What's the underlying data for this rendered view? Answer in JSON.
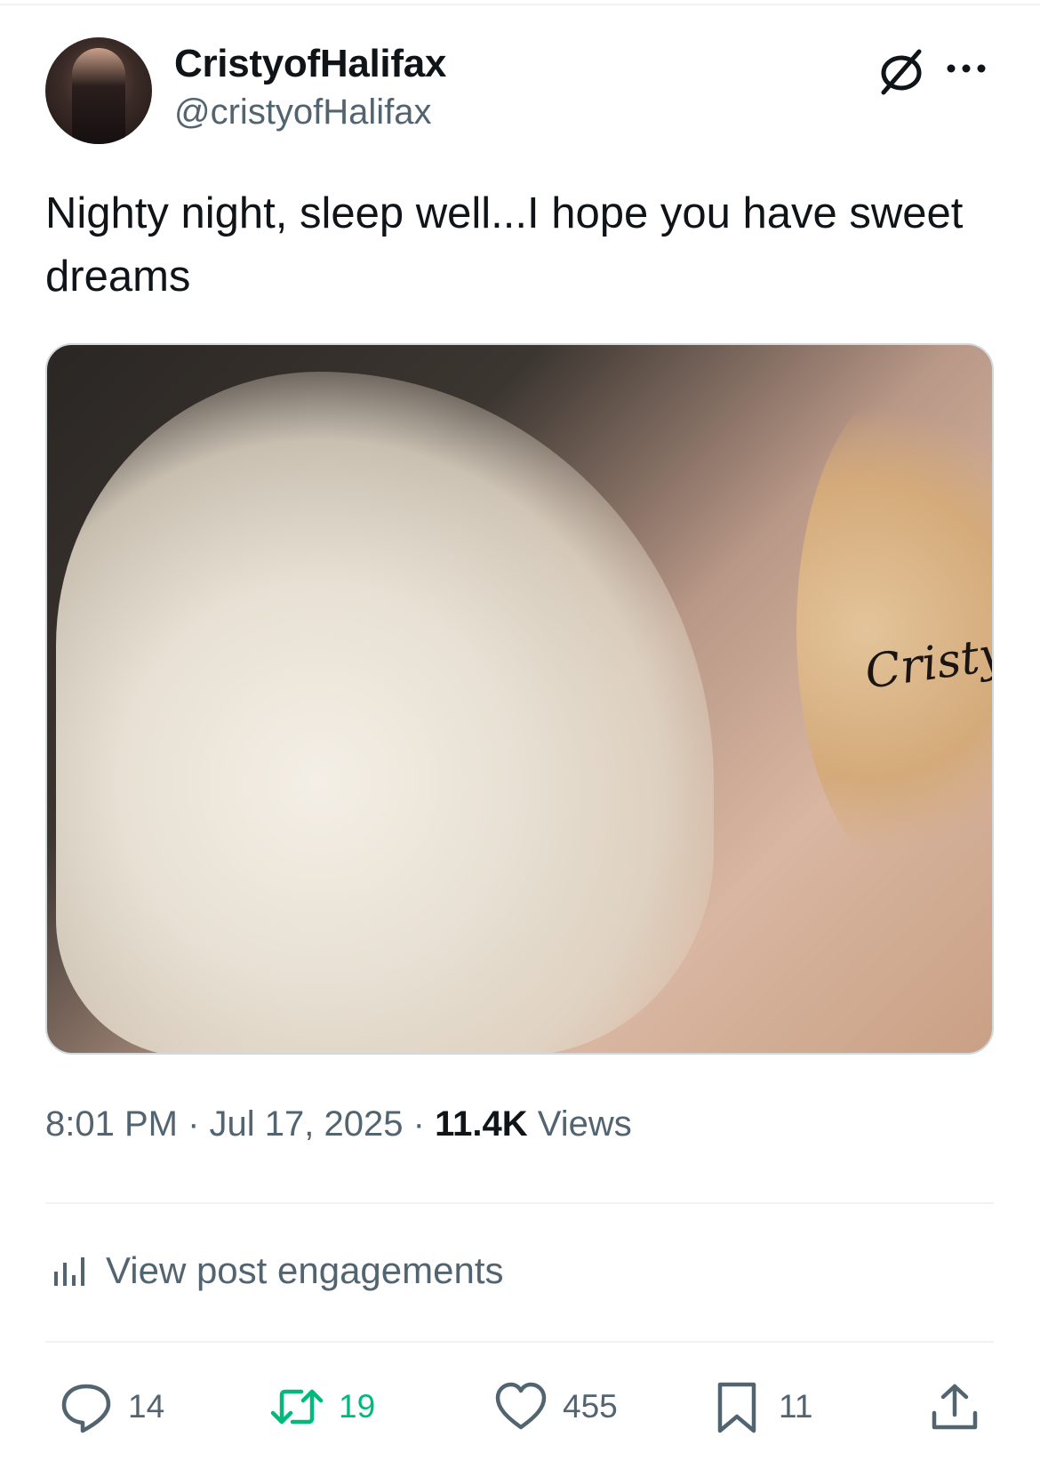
{
  "post": {
    "display_name": "CristyofHalifax",
    "handle": "@cristyofHalifax",
    "text": "Nighty night, sleep well...I hope you have sweet dreams",
    "media_watermark": "Cristy",
    "time": "8:01 PM",
    "separator": "·",
    "date": "Jul 17, 2025",
    "views_count": "11.4K",
    "views_label": "Views"
  },
  "engagements_link": "View post engagements",
  "actions": {
    "replies": "14",
    "reposts": "19",
    "likes": "455",
    "bookmarks": "11"
  },
  "colors": {
    "text_primary": "#0f1419",
    "text_secondary": "#536471",
    "repost_green": "#00ba7c",
    "divider": "#eff3f4"
  },
  "icons": [
    "grok-icon",
    "more-icon",
    "chart-icon",
    "reply-icon",
    "repost-icon",
    "like-icon",
    "bookmark-icon",
    "share-icon"
  ]
}
